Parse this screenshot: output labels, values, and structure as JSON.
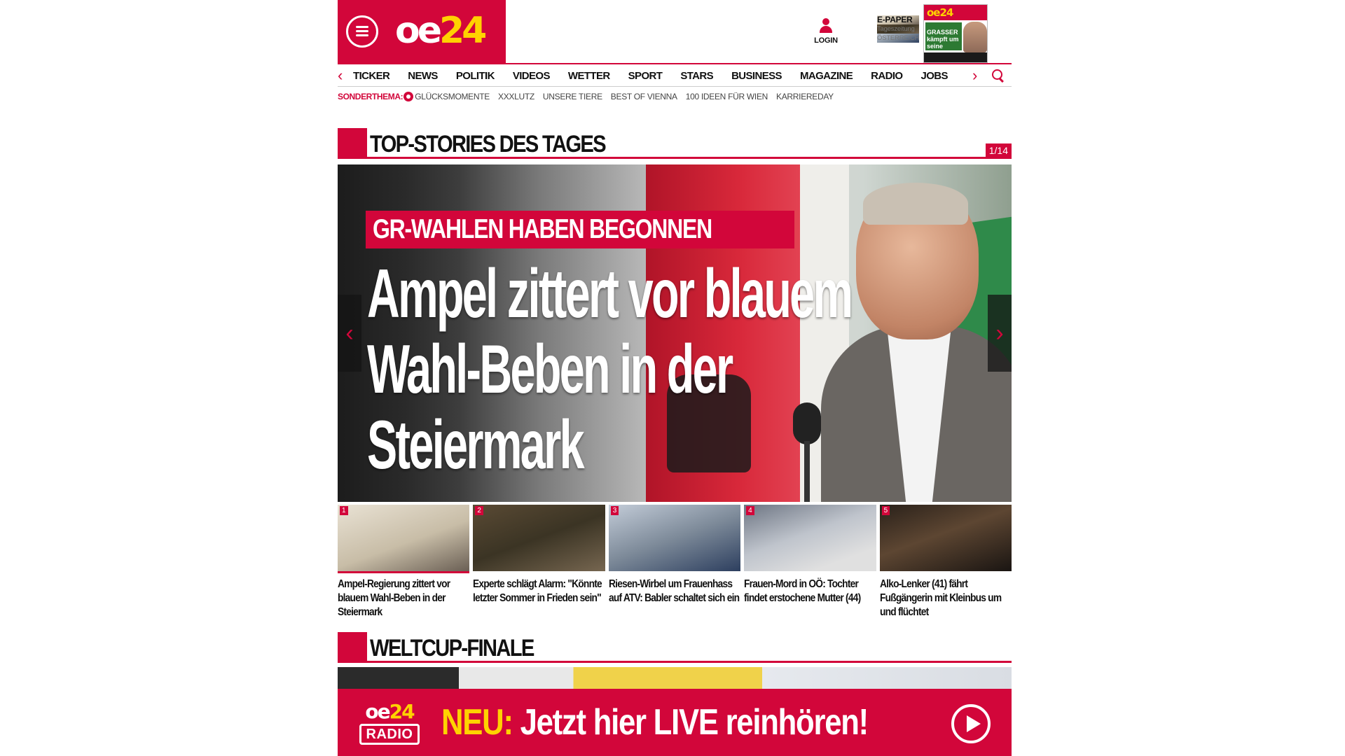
{
  "header": {
    "logo": {
      "part1": "oe",
      "part2": "24"
    },
    "login_label": "LOGIN",
    "epaper": {
      "title": "E-PAPER",
      "line2": "Tageszeitung",
      "line3": "ÖSTERREICH"
    },
    "cover_headline": "GRASSER kämpft um seine Freiheit"
  },
  "nav": {
    "items": [
      "TICKER",
      "NEWS",
      "POLITIK",
      "VIDEOS",
      "WETTER",
      "SPORT",
      "STARS",
      "BUSINESS",
      "MAGAZINE",
      "RADIO",
      "JOBS"
    ]
  },
  "subnav": {
    "label": "SONDERTHEMA:",
    "items": [
      "GLÜCKSMOMENTE",
      "XXXLUTZ",
      "UNSERE TIERE",
      "BEST OF VIENNA",
      "100 IDEEN FÜR WIEN",
      "KARRIEREDAY"
    ]
  },
  "topstories": {
    "title": "TOP-STORIES DES TAGES",
    "counter": "1/14"
  },
  "hero": {
    "kicker": "GR-WAHLEN HABEN BEGONNEN",
    "headline": "Ampel zittert vor blauem Wahl-Beben in der Steiermark"
  },
  "thumbs": [
    {
      "num": "1",
      "text": "Ampel-Regierung zittert vor blauem Wahl-Beben in der Steiermark"
    },
    {
      "num": "2",
      "text": "Experte schlägt Alarm: \"Könnte letzter Sommer in Frieden sein\""
    },
    {
      "num": "3",
      "text": "Riesen-Wirbel um Frauenhass auf ATV: Babler schaltet sich ein"
    },
    {
      "num": "4",
      "text": "Frauen-Mord in OÖ: Tochter findet erstochene Mutter (44)"
    },
    {
      "num": "5",
      "text": "Alko-Lenker (41) fährt Fußgängerin mit Kleinbus um und flüchtet"
    }
  ],
  "weltcup": {
    "title": "WELTCUP-FINALE"
  },
  "radio_banner": {
    "logo_top_oe": "oe",
    "logo_top_24": "24",
    "logo_bottom": "RADIO",
    "neu": "NEU:",
    "text": "Jetzt hier LIVE reinhören!"
  },
  "colors": {
    "brand_red": "#d2063a",
    "brand_yellow": "#ffd200"
  }
}
